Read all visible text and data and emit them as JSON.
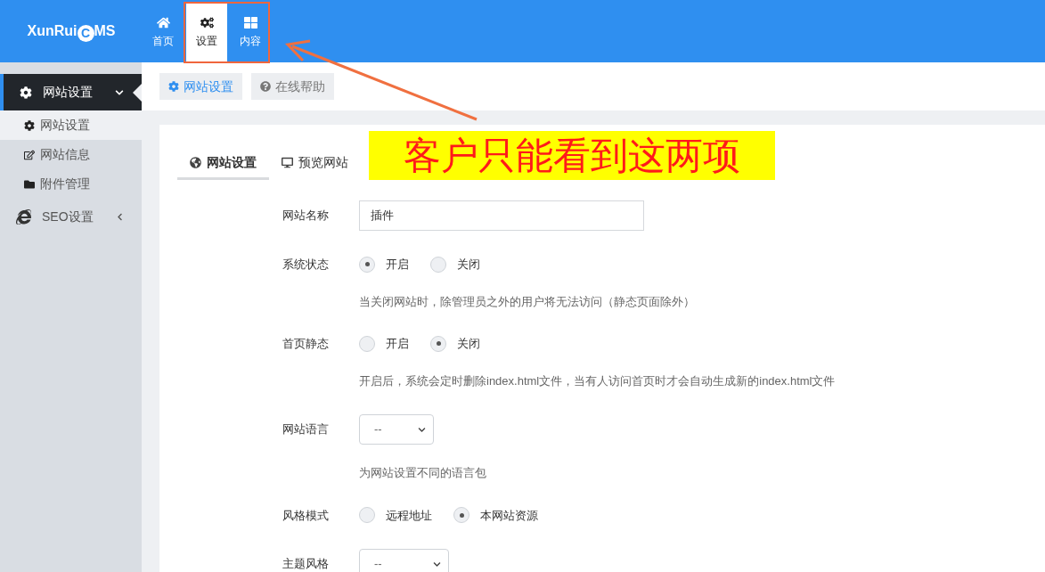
{
  "header": {
    "logo": {
      "before": "XunRui",
      "mark": "C",
      "after": "MS"
    },
    "nav": [
      {
        "label": "首页",
        "selected": false
      },
      {
        "label": "设置",
        "selected": true
      },
      {
        "label": "内容",
        "selected": false
      }
    ]
  },
  "annotation": {
    "callout": "客户只能看到这两项"
  },
  "sidebar": {
    "groups": [
      {
        "label": "网站设置",
        "expanded": true,
        "children": [
          {
            "label": "网站设置",
            "selected": true
          },
          {
            "label": "网站信息",
            "selected": false
          },
          {
            "label": "附件管理",
            "selected": false
          }
        ]
      },
      {
        "label": "SEO设置",
        "expanded": false
      }
    ]
  },
  "toolbar": [
    {
      "label": "网站设置",
      "selected": true
    },
    {
      "label": "在线帮助",
      "selected": false
    }
  ],
  "tabs": [
    {
      "label": "网站设置",
      "selected": true
    },
    {
      "label": "预览网站",
      "selected": false
    }
  ],
  "form": [
    {
      "kind": "text",
      "label": "网站名称",
      "value": "插件"
    },
    {
      "kind": "radio",
      "label": "系统状态",
      "options": [
        {
          "label": "开启",
          "selected": true
        },
        {
          "label": "关闭",
          "selected": false
        }
      ],
      "help": "当关闭网站时，除管理员之外的用户将无法访问（静态页面除外）"
    },
    {
      "kind": "radio",
      "label": "首页静态",
      "options": [
        {
          "label": "开启",
          "selected": false
        },
        {
          "label": "关闭",
          "selected": true
        }
      ],
      "help": "开启后，系统会定时删除index.html文件，当有人访问首页时才会自动生成新的index.html文件"
    },
    {
      "kind": "select",
      "label": "网站语言",
      "value": "--",
      "help": "为网站设置不同的语言包",
      "wide": false
    },
    {
      "kind": "radio",
      "label": "风格模式",
      "options": [
        {
          "label": "远程地址",
          "selected": false
        },
        {
          "label": "本网站资源",
          "selected": true
        }
      ]
    },
    {
      "kind": "select",
      "label": "主题风格",
      "value": "--",
      "wide": true
    }
  ]
}
